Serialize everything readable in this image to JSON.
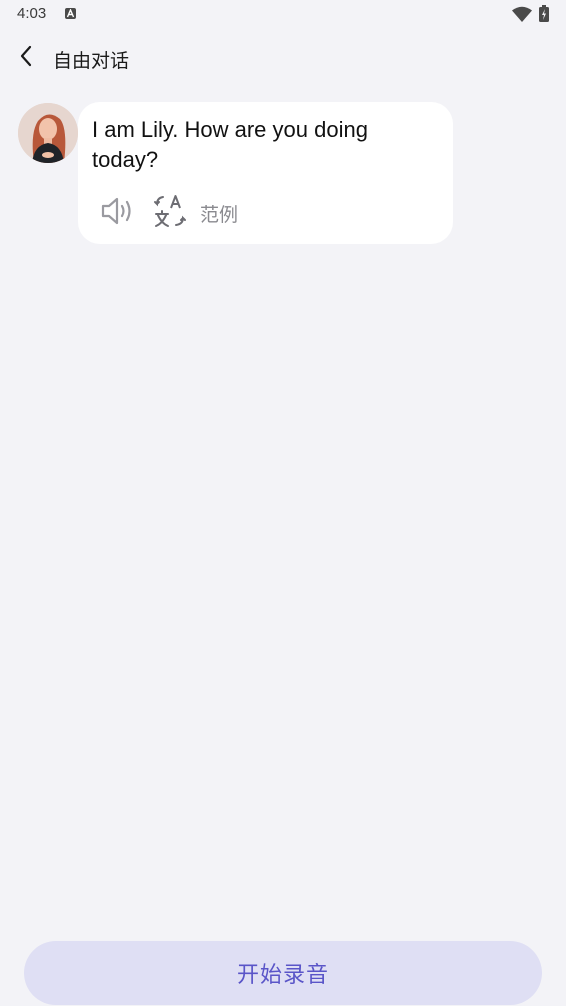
{
  "status_bar": {
    "time": "4:03",
    "app_icon": "text-a-icon",
    "wifi_icon": "wifi-icon",
    "battery_icon": "battery-charging-icon"
  },
  "header": {
    "back_icon": "chevron-left-icon",
    "title": "自由对话"
  },
  "conversation": {
    "messages": [
      {
        "avatar": "avatar-lily",
        "text": "I am Lily. How are you doing today?",
        "actions": {
          "speaker_icon": "speaker-icon",
          "translate_icon": "translate-icon",
          "example_label": "范例"
        }
      }
    ]
  },
  "footer": {
    "record_label": "开始录音"
  },
  "colors": {
    "background": "#f3f3f7",
    "bubble": "#ffffff",
    "record_bg": "#dfdff4",
    "record_text": "#5a55c8",
    "muted": "#8a8a8f"
  }
}
